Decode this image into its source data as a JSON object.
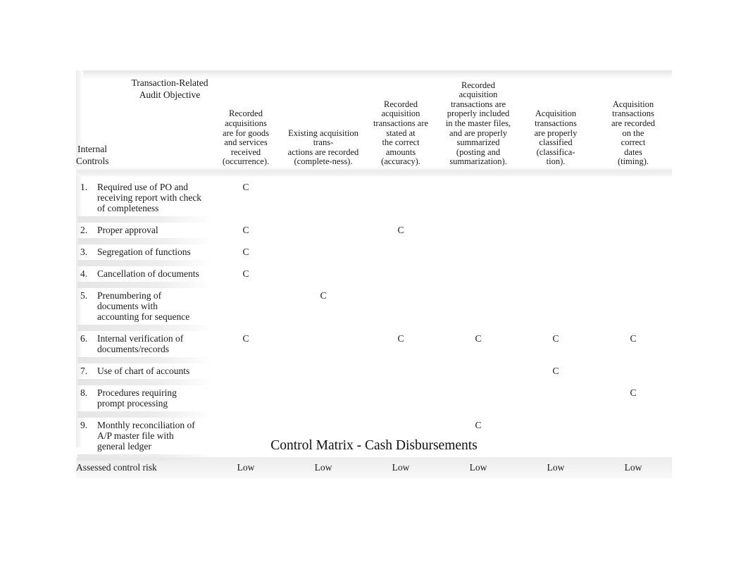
{
  "caption": "Control Matrix - Cash Disbursements",
  "header": {
    "corner_title": "Transaction-Related\nAudit Objective",
    "corner_left": "Internal\nControls",
    "objectives": [
      "Recorded\nacquisitions\nare for goods\nand services\nreceived\n(occurrence).",
      "Existing acquisition\ntrans-\nactions are recorded\n(complete-ness).",
      "Recorded\nacquisition\ntransactions are\nstated at\nthe correct\namounts\n(accuracy).",
      "Recorded\nacquisition\ntransactions are\nproperly included\nin the master files,\nand are properly\nsummarized\n(posting and\nsummarization).",
      "Acquisition\ntransactions\nare properly\nclassified\n(classifica-\ntion).",
      "Acquisition\ntransactions\nare recorded\non the\ncorrect\ndates\n(timing)."
    ]
  },
  "mark_symbol": "C",
  "rows": [
    {
      "num": "1.",
      "label": "Required use of PO and\nreceiving report with check\nof completeness",
      "marks": [
        "C",
        "",
        "",
        "",
        "",
        ""
      ]
    },
    {
      "num": "2.",
      "label": "Proper approval",
      "marks": [
        "C",
        "",
        "C",
        "",
        "",
        ""
      ]
    },
    {
      "num": "3.",
      "label": "Segregation of functions",
      "marks": [
        "C",
        "",
        "",
        "",
        "",
        ""
      ]
    },
    {
      "num": "4.",
      "label": "Cancellation of documents",
      "marks": [
        "C",
        "",
        "",
        "",
        "",
        ""
      ]
    },
    {
      "num": "5.",
      "label": "Prenumbering of\ndocuments with\naccounting for sequence",
      "marks": [
        "",
        "C",
        "",
        "",
        "",
        ""
      ]
    },
    {
      "num": "6.",
      "label": "Internal verification of\ndocuments/records",
      "marks": [
        "C",
        "",
        "C",
        "C",
        "C",
        "C"
      ]
    },
    {
      "num": "7.",
      "label": "Use of chart of accounts",
      "marks": [
        "",
        "",
        "",
        "",
        "C",
        ""
      ]
    },
    {
      "num": "8.",
      "label": "Procedures requiring\nprompt processing",
      "marks": [
        "",
        "",
        "",
        "",
        "",
        "C"
      ]
    },
    {
      "num": "9.",
      "label": "Monthly reconciliation of\nA/P master file with\ngeneral ledger",
      "marks": [
        "",
        "",
        "",
        "C",
        "",
        ""
      ]
    }
  ],
  "risk": {
    "label": "Assessed control risk",
    "values": [
      "Low",
      "Low",
      "Low",
      "Low",
      "Low",
      "Low"
    ]
  }
}
